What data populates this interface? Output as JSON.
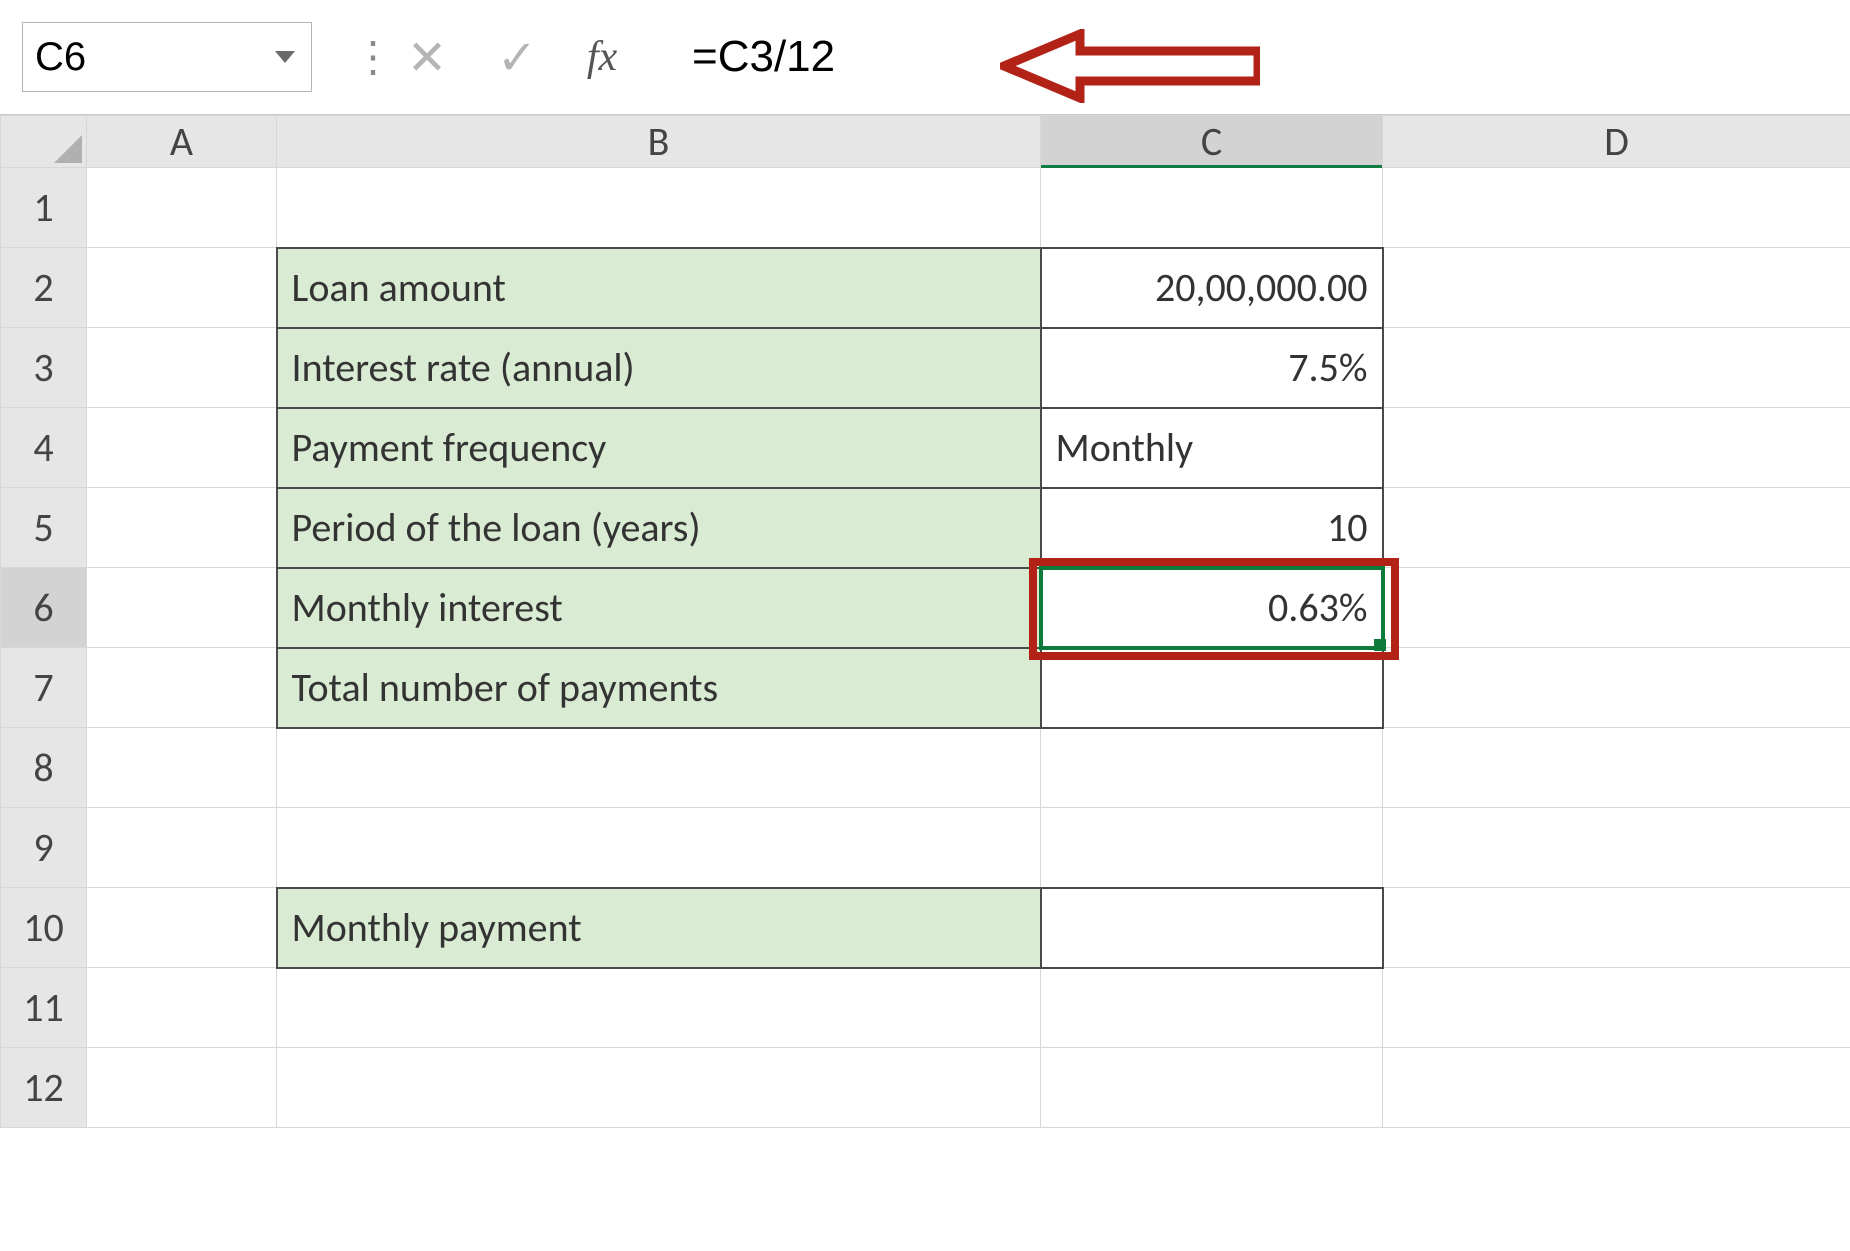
{
  "name_box": {
    "value": "C6"
  },
  "formula_bar": {
    "cancel_glyph": "✕",
    "enter_glyph": "✓",
    "fx_label": "fx",
    "value": "=C3/12"
  },
  "columns": {
    "A": "A",
    "B": "B",
    "C": "C",
    "D": "D"
  },
  "rows": [
    "1",
    "2",
    "3",
    "4",
    "5",
    "6",
    "7",
    "8",
    "9",
    "10",
    "11",
    "12"
  ],
  "cells": {
    "B2": "Loan amount",
    "C2": "20,00,000.00",
    "B3": "Interest rate (annual)",
    "C3": "7.5%",
    "B4": "Payment frequency",
    "C4": "Monthly",
    "B5": "Period of the loan (years)",
    "C5": "10",
    "B6": "Monthly interest",
    "C6": "0.63%",
    "B7": "Total number of payments",
    "C7": "",
    "B10": "Monthly payment",
    "C10": ""
  },
  "active_cell": "C6"
}
